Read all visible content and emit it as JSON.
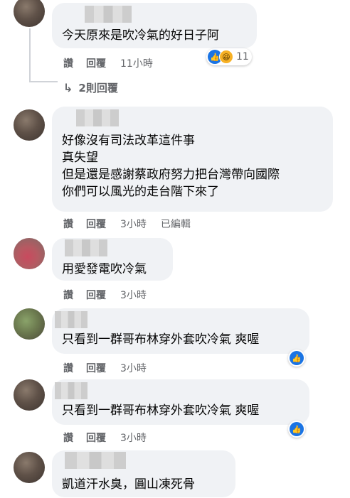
{
  "comments": [
    {
      "text_lines": [
        "今天原來是吹冷氣的好日子阿"
      ],
      "actions": {
        "like": "讚",
        "reply": "回覆",
        "time": "11小時"
      },
      "reaction_count": "11"
    },
    {
      "text_lines": [
        "好像沒有司法改革這件事",
        "真失望",
        "但是還是感謝蔡政府努力把台灣帶向國際",
        "你們可以風光的走台階下來了"
      ],
      "actions": {
        "like": "讚",
        "reply": "回覆",
        "time": "3小時",
        "edited": "已編輯"
      }
    },
    {
      "text_lines": [
        "用愛發電吹冷氣"
      ],
      "actions": {
        "like": "讚",
        "reply": "回覆",
        "time": "3小時"
      }
    },
    {
      "text_lines": [
        "只看到一群哥布林穿外套吹冷氣 爽喔"
      ],
      "actions": {
        "like": "讚",
        "reply": "回覆",
        "time": "3小時"
      }
    },
    {
      "text_lines": [
        "只看到一群哥布林穿外套吹冷氣 爽喔"
      ],
      "actions": {
        "like": "讚",
        "reply": "回覆",
        "time": "3小時"
      }
    },
    {
      "text_lines": [
        "凱道汗水臭，圓山凍死骨"
      ]
    }
  ],
  "replies_link": "2則回覆",
  "icons": {
    "like": "thumbs-up-icon",
    "haha": "haha-face-icon",
    "reply_arrow": "reply-arrow-icon"
  },
  "colors": {
    "bubble": "#f0f2f5",
    "meta": "#65676b",
    "like_blue": "#1b74e4"
  }
}
